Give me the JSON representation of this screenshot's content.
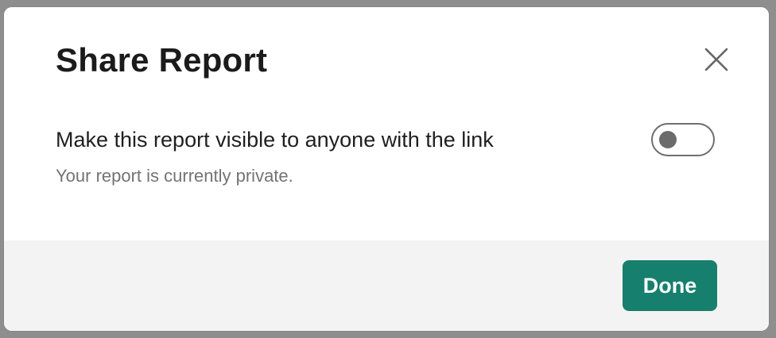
{
  "dialog": {
    "title": "Share Report",
    "close_icon": "close-icon"
  },
  "visibility_setting": {
    "label": "Make this report visible to anyone with the link",
    "hint": "Your report is currently private.",
    "toggle_enabled": false
  },
  "footer": {
    "done_label": "Done"
  },
  "colors": {
    "primary": "#177f6d",
    "title_text": "#1b1b1b",
    "hint_text": "#737373",
    "footer_bg": "#f3f3f3",
    "toggle_border": "#6f6f6f"
  }
}
